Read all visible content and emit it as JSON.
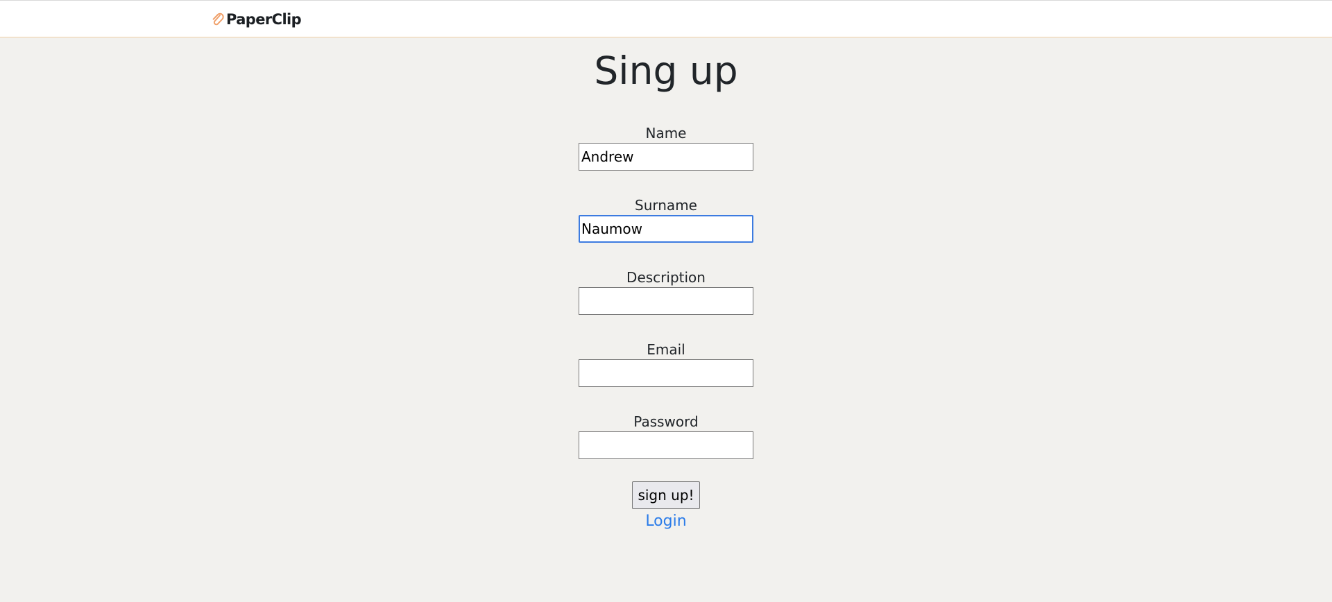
{
  "header": {
    "brand_name": "PaperClip",
    "brand_icon": "paperclip-icon",
    "brand_icon_color": "#f0a06a"
  },
  "page": {
    "title": "Sing up"
  },
  "form": {
    "name": {
      "label": "Name",
      "value": "Andrew"
    },
    "surname": {
      "label": "Surname",
      "value": "Naumow"
    },
    "description": {
      "label": "Description",
      "value": ""
    },
    "email": {
      "label": "Email",
      "value": ""
    },
    "password": {
      "label": "Password",
      "value": ""
    },
    "submit_label": "sign up!",
    "login_link_label": "Login"
  },
  "colors": {
    "background": "#f2f1ee",
    "link": "#2b7ce9",
    "focus_border": "#3c7be0"
  }
}
